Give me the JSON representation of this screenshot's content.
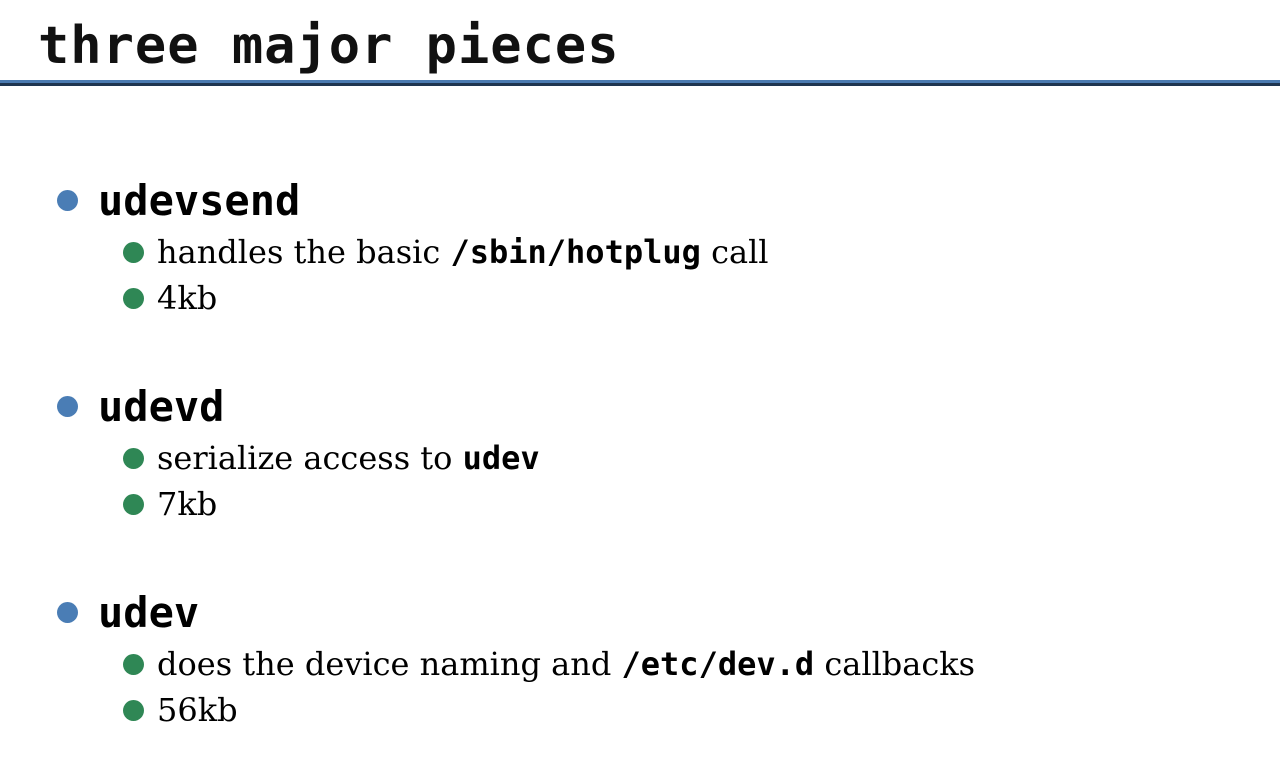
{
  "slide": {
    "title": "three major pieces",
    "colors": {
      "title_rule": "#4a7ab0",
      "level1_bullet": "#4a7db5",
      "level2_bullet": "#2f8755"
    }
  },
  "items": [
    {
      "heading": "udevsend",
      "details": [
        {
          "before": "handles the basic ",
          "code": "/sbin/hotplug",
          "after": " call"
        },
        {
          "text": "4kb"
        }
      ]
    },
    {
      "heading": "udevd",
      "details": [
        {
          "before": "serialize access to ",
          "code": "udev",
          "after": ""
        },
        {
          "text": "7kb"
        }
      ]
    },
    {
      "heading": "udev",
      "details": [
        {
          "before": "does the device naming and ",
          "code": "/etc/dev.d",
          "after": " callbacks"
        },
        {
          "text": "56kb"
        }
      ]
    }
  ]
}
